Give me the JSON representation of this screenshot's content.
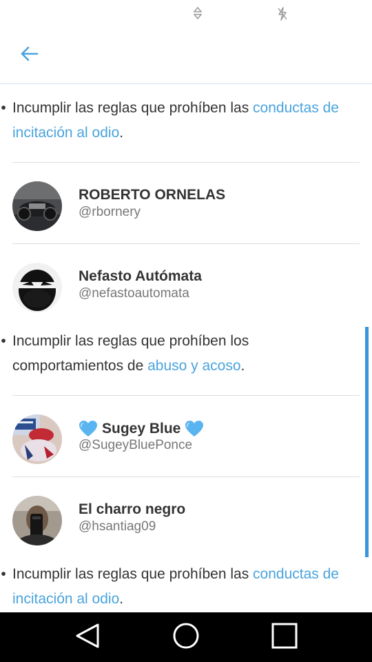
{
  "status_bar": {
    "icons": [
      "data-arrows-icon",
      "no-charge-icon"
    ]
  },
  "app_bar": {
    "back_icon": "arrow-left-icon",
    "accent": "#4aa3de"
  },
  "rules": [
    {
      "text": "Incumplir las reglas que prohíben las ",
      "link": "conductas de incitación al odio",
      "suffix": "."
    },
    {
      "text": "Incumplir las reglas que prohíben los comportamientos de ",
      "link": "abuso y acoso",
      "suffix": "."
    },
    {
      "text": "Incumplir las reglas que prohíben las ",
      "link": "conductas de incitación al odio",
      "suffix": "."
    }
  ],
  "users": [
    {
      "name": "ROBERTO ORNELAS",
      "handle": "@rbornery"
    },
    {
      "name": "Nefasto Autómata",
      "handle": "@nefastoautomata"
    },
    {
      "name": "Sugey Blue",
      "handle": "@SugeyBluePonce",
      "name_icons": [
        "blue-heart-icon",
        "blue-heart-icon"
      ]
    },
    {
      "name": "El charro negro",
      "handle": "@hsantiag09"
    }
  ],
  "nav_bar": {
    "icons": [
      "back-triangle-icon",
      "home-circle-icon",
      "recents-square-icon"
    ]
  },
  "colors": {
    "link": "#4aa3de",
    "scrollbar": "#3a95dc",
    "text": "#333333",
    "handle": "#777777"
  }
}
